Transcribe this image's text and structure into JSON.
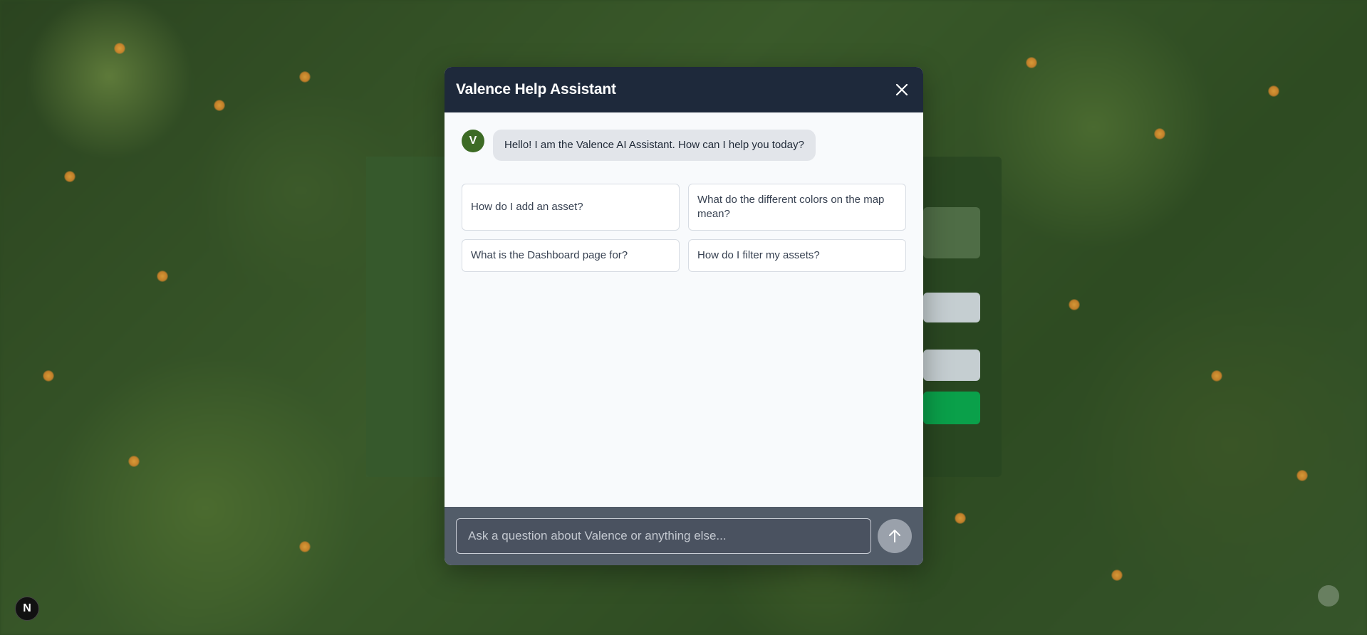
{
  "modal": {
    "title": "Valence Help Assistant",
    "close_icon": "close-icon"
  },
  "chat": {
    "avatar_letter": "V",
    "greeting": "Hello! I am the Valence AI Assistant. How can I help you today?"
  },
  "suggestions": [
    "How do I add an asset?",
    "What do the different colors on the map mean?",
    "What is the Dashboard page for?",
    "How do I filter my assets?"
  ],
  "input": {
    "placeholder": "Ask a question about Valence or anything else...",
    "value": ""
  },
  "send_icon": "arrow-up-icon",
  "badge": {
    "letter": "N"
  },
  "colors": {
    "header": "#1e293b",
    "avatar": "#3d6b25",
    "input_bar": "#525c69"
  }
}
